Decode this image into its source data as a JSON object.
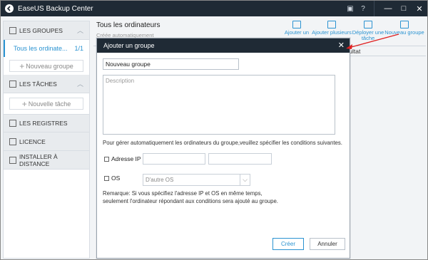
{
  "app": {
    "title": "EaseUS Backup Center"
  },
  "titlebar": {
    "icons": [
      "window-icon",
      "help-icon"
    ],
    "minimize": "—",
    "maximize": "□",
    "close": "✕"
  },
  "sidebar": {
    "groups_header": "LES GROUPES",
    "selected_group": {
      "label": "Tous les ordinate...",
      "count": "1/1"
    },
    "add_group": "Nouveau groupe",
    "tasks_header": "LES TÂCHES",
    "add_task": "Nouvelle tâche",
    "registers": "LES REGISTRES",
    "license": "LICENCE",
    "remote_install": "INSTALLER À DISTANCE"
  },
  "main": {
    "title": "Tous les ordinateurs",
    "subtitle": "Créée automatiquement",
    "toolbar": [
      {
        "label": "Ajouter un",
        "icon": "monitor-icon"
      },
      {
        "label": "Ajouter plusieurs",
        "icon": "multi-monitor-icon"
      },
      {
        "label": "Déployer une tâche",
        "icon": "deploy-icon"
      },
      {
        "label": "Nouveau groupe",
        "icon": "group-icon"
      }
    ],
    "column_header": "sultat"
  },
  "dialog": {
    "title": "Ajouter un groupe",
    "name_value": "Nouveau groupe",
    "description_placeholder": "Description",
    "hint": "Pour gérer automatiquement les ordinateurs du groupe,veuillez spécifier les conditions suivantes.",
    "ip_label": "Adresse IP",
    "os_label": "OS",
    "os_selected": "D'autre OS",
    "remark_line1": "Remarque: Si vous spécifiez l'adresse IP et OS en même temps,",
    "remark_line2": "seulement l'ordinateur répondant aux conditions sera ajouté au groupe.",
    "create_button": "Créer",
    "cancel_button": "Annuler"
  },
  "colors": {
    "accent": "#2b93d1",
    "titlebar": "#1f2a35",
    "annotation": "#e02020"
  }
}
